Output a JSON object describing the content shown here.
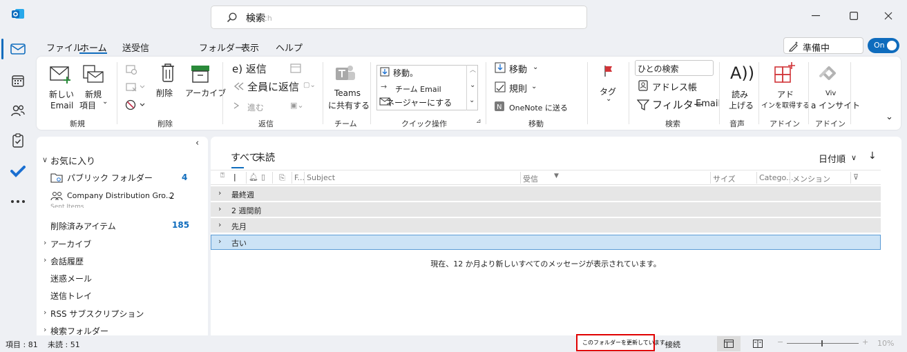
{
  "titlebar": {
    "search_label": "検索",
    "search_ghost": "Search"
  },
  "menu": {
    "tabs": [
      "ファイル",
      "ホーム",
      "送受信",
      "フォルダー",
      "表示",
      "ヘルプ"
    ]
  },
  "status_pill": {
    "label": "準備中",
    "toggle_label": "On"
  },
  "ribbon": {
    "new": {
      "new_email_1": "新しい",
      "new_email_2": "Email",
      "new_item_1": "新規",
      "new_item_2": "項目",
      "group": "新規"
    },
    "delete": {
      "delete": "削除",
      "archive": "アーカイブ",
      "group": "削除"
    },
    "respond": {
      "reply": "e) 返信",
      "reply_all": "全員に返信",
      "forward": "進む",
      "group": "返信"
    },
    "teams": {
      "share_1": "Teams",
      "share_2": "に共有する",
      "group": "チーム"
    },
    "quick_steps": {
      "item1": "移動。",
      "item2": "チーム Email",
      "item3": "ネージャーにする",
      "group": "クイック操作"
    },
    "move": {
      "move": "移動",
      "rules": "規則",
      "onenote": "OneNote に送る",
      "group": "移動"
    },
    "tags": {
      "tag": "タグ"
    },
    "find": {
      "search_people": "ひとの検索",
      "address_book": "アドレス帳",
      "filter": "フィルター",
      "filter_email": "Email",
      "group": "検索"
    },
    "speech": {
      "icon_text": "A))",
      "read_1": "読み",
      "read_2": "上げる",
      "group": "音声"
    },
    "addins": {
      "get_1": "アド",
      "get_2": "インを取得する",
      "group": "アドイン"
    },
    "viva": {
      "l1": "Viv",
      "l2": "a インサイト",
      "group": "アドイン"
    }
  },
  "folders": {
    "favorites": "お気に入り",
    "public_folder": "パブリック フォルダー",
    "public_folder_count": "4",
    "company_group": "Company Distribution Gro...",
    "company_group_count": "2",
    "sent_items_clipped": "Sent Items",
    "deleted": "削除済みアイテム",
    "deleted_count": "185",
    "archive": "アーカイブ",
    "conversation_history": "会話履歴",
    "junk": "迷惑メール",
    "outbox": "送信トレイ",
    "rss": "RSS サブスクリプション",
    "search_folders": "検索フォルダー"
  },
  "messages": {
    "filter_all": "すべて",
    "filter_unread": "未読",
    "sort_label": "日付順",
    "columns": {
      "f": "F...",
      "subject": "Subject",
      "received": "受信",
      "size": "サイズ",
      "category": "Catego...",
      "mention": "メンション"
    },
    "groups": [
      "最終週",
      "2 週間前",
      "先月",
      "古い"
    ],
    "info": "現在、12 か月より新しいすべてのメッセージが表示されています。"
  },
  "statusbar": {
    "items": "項目 : 81",
    "unread": "未読 : 51",
    "updating": "このフォルダーを更新しています。",
    "connected": "接続",
    "zoom": "10%"
  },
  "colors": {
    "accent": "#0f6cbd",
    "highlight": "#e00000"
  }
}
